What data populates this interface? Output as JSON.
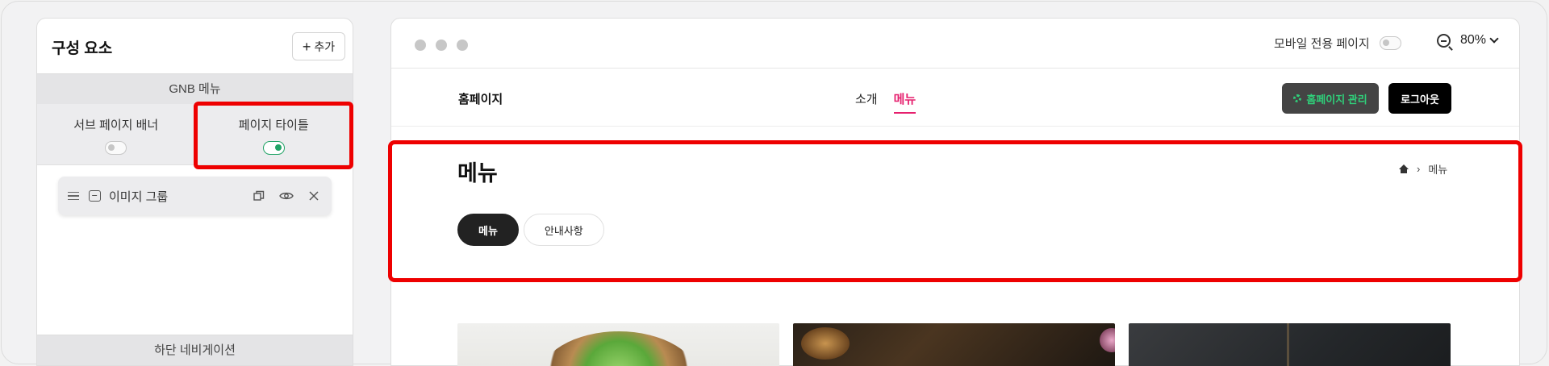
{
  "panel": {
    "title": "구성 요소",
    "add_label": "추가",
    "gnb_label": "GNB 메뉴",
    "options": [
      {
        "label": "서브 페이지 배너",
        "enabled": false
      },
      {
        "label": "페이지 타이틀",
        "enabled": true
      }
    ],
    "item_label": "이미지 그룹",
    "bottom_label": "하단 네비게이션"
  },
  "toolbar": {
    "mobile_only_label": "모바일 전용 페이지",
    "mobile_only_enabled": false,
    "zoom": "80%"
  },
  "site": {
    "logo": "홈페이지",
    "menu": [
      "소개",
      "메뉴"
    ],
    "active_menu": "메뉴",
    "manage_label": "홈페이지 관리",
    "logout_label": "로그아웃"
  },
  "page": {
    "title": "메뉴",
    "breadcrumb_current": "메뉴",
    "tabs": [
      "메뉴",
      "안내사항"
    ]
  },
  "colors": {
    "accent": "#e6206e",
    "highlight": "#ee0000",
    "toggle_on": "#21a366"
  }
}
